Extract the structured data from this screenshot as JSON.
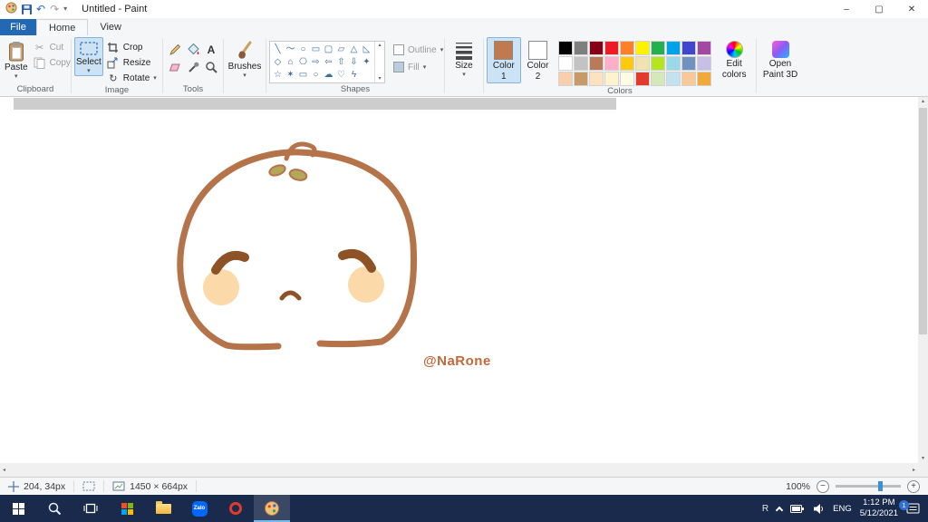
{
  "titlebar": {
    "title": "Untitled - Paint",
    "minimize": "–",
    "maximize": "▢",
    "close": "✕"
  },
  "menu": {
    "file": "File",
    "home": "Home",
    "view": "View"
  },
  "ribbon": {
    "clipboard": {
      "label": "Clipboard",
      "paste": "Paste",
      "cut": "Cut",
      "copy": "Copy"
    },
    "image": {
      "label": "Image",
      "select": "Select",
      "crop": "Crop",
      "resize": "Resize",
      "rotate": "Rotate"
    },
    "tools": {
      "label": "Tools",
      "text_tool": "A"
    },
    "brushes": {
      "label": "Brushes"
    },
    "shapes": {
      "label": "Shapes",
      "outline": "Outline",
      "fill": "Fill",
      "items": [
        {
          "name": "line",
          "glyph": "╲"
        },
        {
          "name": "curve",
          "glyph": "～"
        },
        {
          "name": "oval",
          "glyph": "○"
        },
        {
          "name": "rectangle",
          "glyph": "▭"
        },
        {
          "name": "rounded-rectangle",
          "glyph": "▢"
        },
        {
          "name": "polygon",
          "glyph": "▱"
        },
        {
          "name": "triangle",
          "glyph": "△"
        },
        {
          "name": "right-triangle",
          "glyph": "◺"
        },
        {
          "name": "diamond",
          "glyph": "◇"
        },
        {
          "name": "pentagon",
          "glyph": "⌂"
        },
        {
          "name": "hexagon",
          "glyph": "⎔"
        },
        {
          "name": "right-arrow",
          "glyph": "⇨"
        },
        {
          "name": "left-arrow",
          "glyph": "⇦"
        },
        {
          "name": "up-arrow",
          "glyph": "⇧"
        },
        {
          "name": "down-arrow",
          "glyph": "⇩"
        },
        {
          "name": "four-point-star",
          "glyph": "✦"
        },
        {
          "name": "five-point-star",
          "glyph": "☆"
        },
        {
          "name": "six-point-star",
          "glyph": "✶"
        },
        {
          "name": "rounded-callout",
          "glyph": "▭"
        },
        {
          "name": "oval-callout",
          "glyph": "○"
        },
        {
          "name": "cloud-callout",
          "glyph": "☁"
        },
        {
          "name": "heart",
          "glyph": "♡"
        },
        {
          "name": "lightning",
          "glyph": "ϟ"
        }
      ]
    },
    "size": {
      "label": "Size"
    },
    "colors": {
      "label": "Colors",
      "color1_title": "Color",
      "color1_num": "1",
      "color1_value": "#c17a50",
      "color2_title": "Color",
      "color2_num": "2",
      "color2_value": "#ffffff",
      "edit_line1": "Edit",
      "edit_line2": "colors",
      "p3d_line1": "Open",
      "p3d_line2": "Paint 3D",
      "palette": [
        [
          "#000000",
          "#7f7f7f",
          "#880015",
          "#ed1c24",
          "#ff7f27",
          "#fff200",
          "#22b14c",
          "#00a2e8",
          "#3f48cc",
          "#a349a4"
        ],
        [
          "#ffffff",
          "#c3c3c3",
          "#b97a57",
          "#ffaec9",
          "#ffc90e",
          "#efe4b0",
          "#b5e61d",
          "#99d9ea",
          "#7092be",
          "#c8bfe7"
        ],
        [
          "#f7cfae",
          "#c79b67",
          "#fbe3c0",
          "#fdf3cf",
          "#fffbe5",
          "#e23b2e",
          "#d4e8b8",
          "#c2e2ef",
          "#f8c897",
          "#f2a93b"
        ]
      ]
    }
  },
  "canvas": {
    "signature": "@NaRone",
    "signature_color": "#c2683a",
    "outline_color": "#b5734a",
    "cheek_color": "#fbd9a9",
    "brow_color": "#8d5327",
    "leaf_color": "#b3a75a"
  },
  "statusbar": {
    "position": "204, 34px",
    "canvas_size": "1450 × 664px",
    "zoom": "100%"
  },
  "taskbar": {
    "lang": "ENG",
    "time": "1:12 PM",
    "date": "5/12/2021",
    "badge": "1",
    "zalo": "Zalo",
    "tray_app": "R"
  }
}
